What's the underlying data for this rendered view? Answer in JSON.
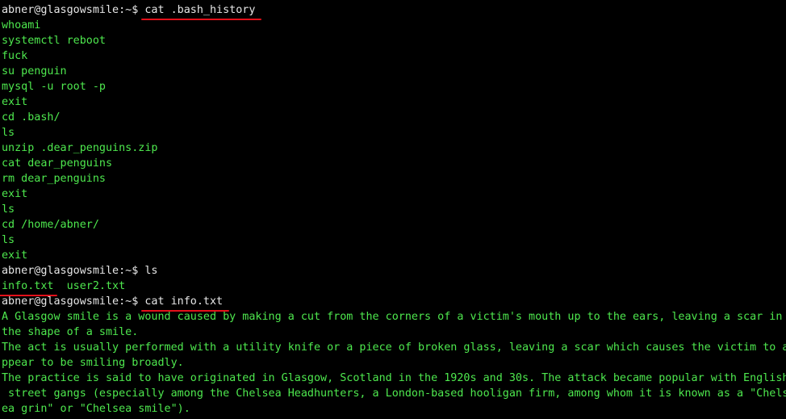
{
  "terminal": {
    "prompt": "abner@glasgowsmile:~$",
    "lines": [
      {
        "type": "prompt",
        "cmd": "cat .bash_history",
        "underline": true
      },
      {
        "type": "out",
        "text": "whoami"
      },
      {
        "type": "out",
        "text": "systemctl reboot"
      },
      {
        "type": "out",
        "text": "fuck"
      },
      {
        "type": "out",
        "text": "su penguin"
      },
      {
        "type": "out",
        "text": "mysql -u root -p"
      },
      {
        "type": "out",
        "text": "exit"
      },
      {
        "type": "out",
        "text": "cd .bash/"
      },
      {
        "type": "out",
        "text": "ls"
      },
      {
        "type": "out",
        "text": "unzip .dear_penguins.zip"
      },
      {
        "type": "out",
        "text": "cat dear_penguins"
      },
      {
        "type": "out",
        "text": "rm dear_penguins"
      },
      {
        "type": "out",
        "text": "exit"
      },
      {
        "type": "out",
        "text": "ls"
      },
      {
        "type": "out",
        "text": "cd /home/abner/"
      },
      {
        "type": "out",
        "text": "ls"
      },
      {
        "type": "out",
        "text": "exit"
      },
      {
        "type": "prompt",
        "cmd": "ls",
        "underline": false
      },
      {
        "type": "files",
        "first": "info.txt",
        "rest": "  user2.txt"
      },
      {
        "type": "prompt",
        "cmd": "cat info.txt",
        "underline": true
      },
      {
        "type": "out",
        "text": "A Glasgow smile is a wound caused by making a cut from the corners of a victim's mouth up to the ears, leaving a scar in"
      },
      {
        "type": "out",
        "text": "the shape of a smile."
      },
      {
        "type": "out",
        "text": "The act is usually performed with a utility knife or a piece of broken glass, leaving a scar which causes the victim to a"
      },
      {
        "type": "out",
        "text": "ppear to be smiling broadly."
      },
      {
        "type": "out",
        "text": "The practice is said to have originated in Glasgow, Scotland in the 1920s and 30s. The attack became popular with English"
      },
      {
        "type": "out",
        "text": " street gangs (especially among the Chelsea Headhunters, a London-based hooligan firm, among whom it is known as a \"Chels"
      },
      {
        "type": "out",
        "text": "ea grin\" or \"Chelsea smile\")."
      }
    ]
  }
}
